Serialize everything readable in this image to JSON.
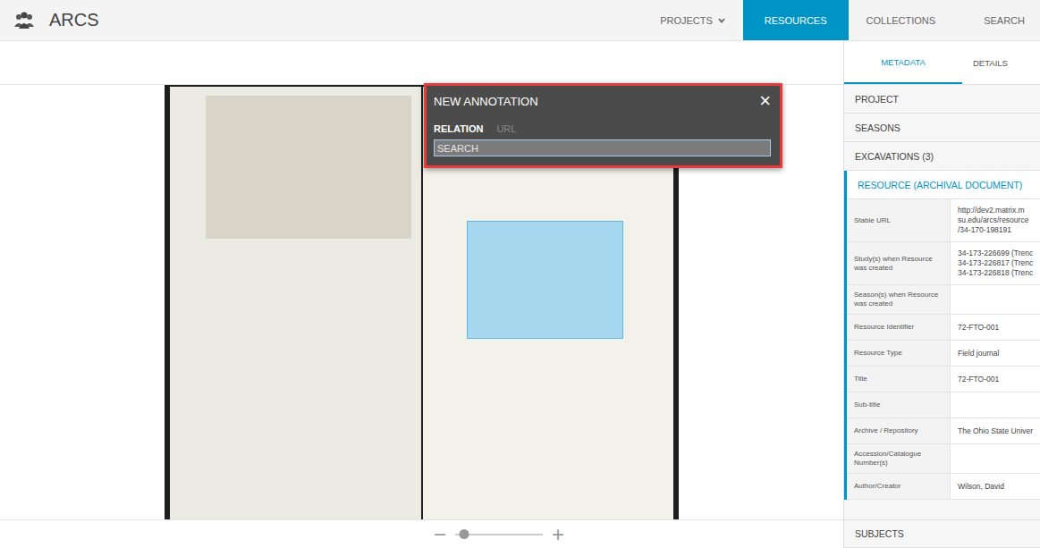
{
  "header": {
    "logo": "ARCS",
    "nav": [
      {
        "label": "PROJECTS",
        "selected": false,
        "has_menu": true
      },
      {
        "label": "RESOURCES",
        "selected": true,
        "has_menu": false
      },
      {
        "label": "COLLECTIONS",
        "selected": false,
        "has_menu": false
      },
      {
        "label": "SEARCH",
        "selected": false,
        "has_menu": false
      }
    ]
  },
  "zoom": {
    "minus": "−",
    "plus": "+",
    "level": 0.1
  },
  "annotation_dialog": {
    "title": "NEW ANNOTATION",
    "close": "×",
    "tabs": [
      {
        "label": "RELATION",
        "selected": true
      },
      {
        "label": "URL",
        "selected": false
      }
    ],
    "search": {
      "placeholder": "SEARCH"
    }
  },
  "panel": {
    "tabs": [
      {
        "label": "METADATA",
        "selected": true
      },
      {
        "label": "DETAILS",
        "selected": false
      }
    ],
    "sections": [
      {
        "label": "PROJECT",
        "expanded": false
      },
      {
        "label": "SEASONS",
        "expanded": false
      },
      {
        "label": "EXCAVATIONS (3)",
        "expanded": false
      }
    ],
    "resource": {
      "label": "RESOURCE (ARCHIVAL DOCUMENT)",
      "expanded": true,
      "fields": [
        {
          "label": "Stable URL",
          "value": [
            "http://dev2.matrix.m",
            "su.edu/arcs/resource",
            "/34-170-198191"
          ]
        },
        {
          "label": "Study(s) when Resource was created",
          "value": [
            "34-173-226699 (Trenc",
            "34-173-226817 (Trenc",
            "34-173-226818 (Trenc"
          ]
        },
        {
          "label": "Season(s) when Resource was created",
          "value": []
        },
        {
          "label": "Resource Identifier",
          "value": [
            "72-FTO-001"
          ]
        },
        {
          "label": "Resource Type",
          "value": [
            "Field journal"
          ]
        },
        {
          "label": "Title",
          "value": [
            "72-FTO-001"
          ]
        },
        {
          "label": "Sub-title",
          "value": []
        },
        {
          "label": "Archive / Repository",
          "value": [
            "The Ohio State Univer"
          ]
        },
        {
          "label": "Accession/Catalogue Number(s)",
          "value": []
        },
        {
          "label": "Author/Creator",
          "value": [
            "Wilson, David"
          ]
        }
      ]
    },
    "footer_section": {
      "label": "SUBJECTS",
      "expanded": false
    }
  }
}
